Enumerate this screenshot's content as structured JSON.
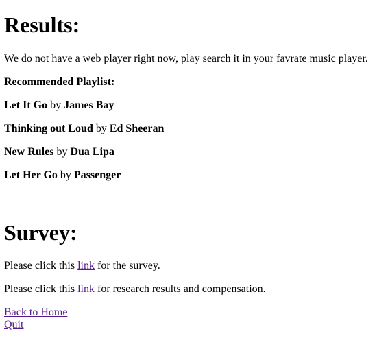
{
  "results": {
    "heading": "Results:",
    "notice": "We do not have a web player right now, play search it in your favrate music player.",
    "playlist_heading": "Recommended Playlist:",
    "by_word": "by",
    "songs": [
      {
        "title": "Let It Go",
        "artist": "James Bay"
      },
      {
        "title": "Thinking out Loud",
        "artist": "Ed Sheeran"
      },
      {
        "title": "New Rules",
        "artist": "Dua Lipa"
      },
      {
        "title": "Let Her Go",
        "artist": "Passenger"
      }
    ]
  },
  "survey": {
    "heading": "Survey:",
    "survey_line": {
      "prefix": "Please click this",
      "link": "link",
      "suffix": "for the survey."
    },
    "research_line": {
      "prefix": "Please click this",
      "link": "link",
      "suffix": "for research results and compensation."
    }
  },
  "nav": {
    "back_home": "Back to Home",
    "quit": "Quit"
  }
}
